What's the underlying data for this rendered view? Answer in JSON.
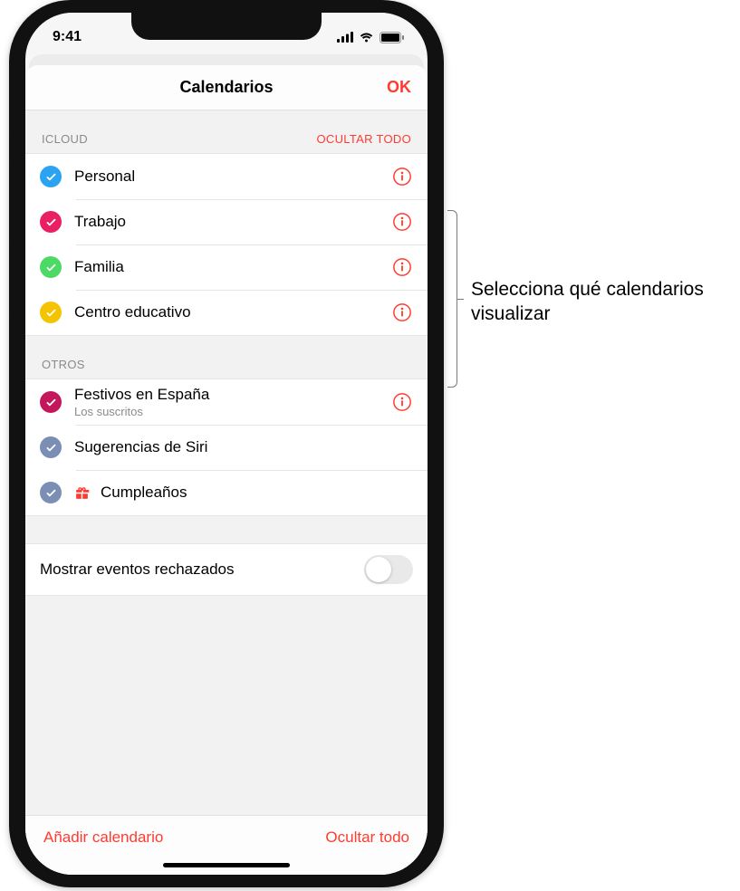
{
  "status": {
    "time": "9:41"
  },
  "nav": {
    "title": "Calendarios",
    "ok": "OK"
  },
  "sections": {
    "icloud": {
      "header": "ICLOUD",
      "hide_all": "OCULTAR TODO",
      "items": [
        {
          "label": "Personal",
          "color": "#2aa3f2"
        },
        {
          "label": "Trabajo",
          "color": "#e91e63"
        },
        {
          "label": "Familia",
          "color": "#4cd964"
        },
        {
          "label": "Centro educativo",
          "color": "#f5c400"
        }
      ]
    },
    "otros": {
      "header": "OTROS",
      "items": [
        {
          "label": "Festivos en España",
          "sub": "Los suscritos",
          "color": "#c2185b",
          "info": true
        },
        {
          "label": "Sugerencias de Siri",
          "color": "#7a8fb3",
          "info": false
        },
        {
          "label": "Cumpleaños",
          "color": "#7a8fb3",
          "info": false,
          "gift": true
        }
      ]
    }
  },
  "switch": {
    "label": "Mostrar eventos rechazados",
    "on": false
  },
  "toolbar": {
    "add": "Añadir calendario",
    "hide_all": "Ocultar todo"
  },
  "callout": {
    "text": "Selecciona qué calendarios visualizar"
  }
}
